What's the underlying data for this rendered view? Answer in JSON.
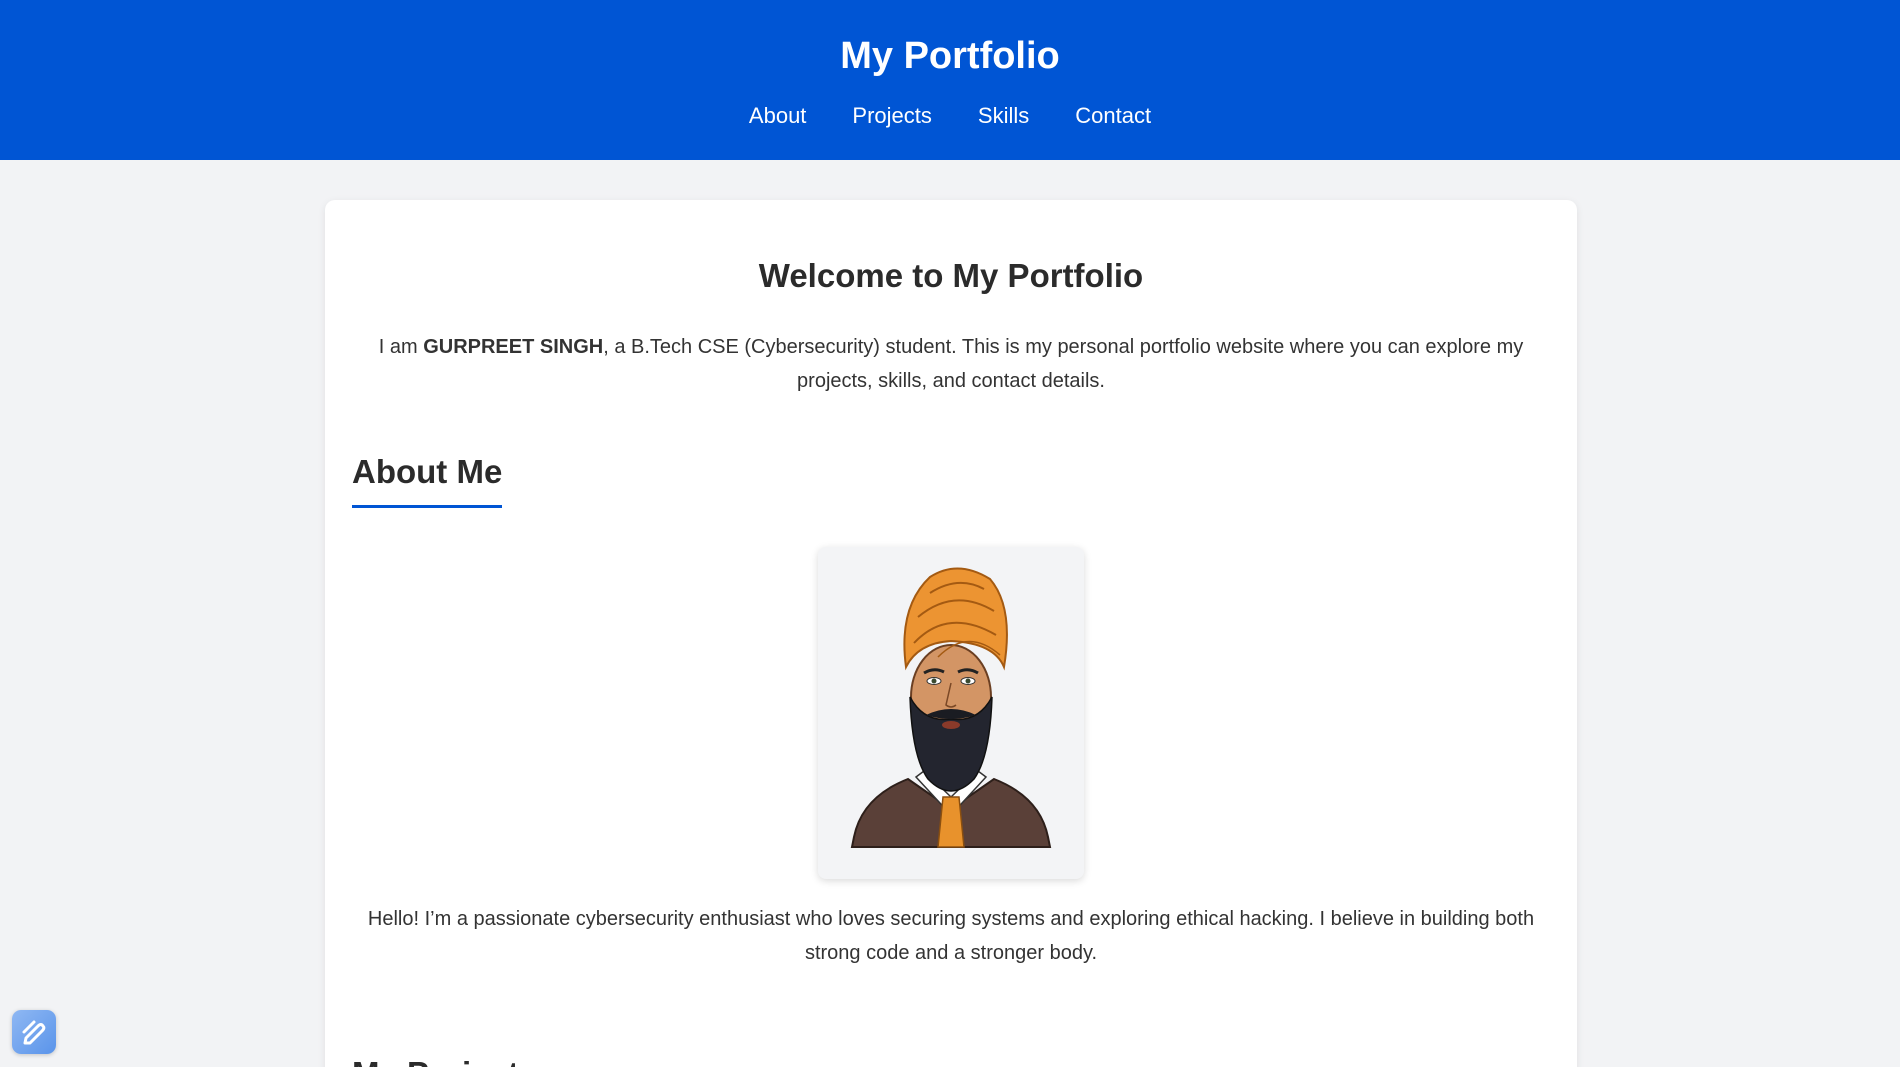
{
  "header": {
    "title": "My Portfolio",
    "nav": [
      {
        "label": "About"
      },
      {
        "label": "Projects"
      },
      {
        "label": "Skills"
      },
      {
        "label": "Contact"
      }
    ],
    "background_color": "#0055d4"
  },
  "welcome": {
    "title": "Welcome to My Portfolio",
    "intro_prefix": "I am ",
    "intro_name": "GURPREET SINGH",
    "intro_suffix": ", a B.Tech CSE (Cybersecurity) student. This is my personal portfolio website where you can explore my projects, skills, and contact details."
  },
  "about": {
    "heading": "About Me",
    "profile_image_alt": "illustrated-portrait",
    "text": "Hello! I’m a passionate cybersecurity enthusiast who loves securing systems and exploring ethical hacking. I believe in building both strong code and a stronger body."
  },
  "projects": {
    "heading": "My Projects"
  },
  "widget": {
    "icon": "edit-pen-icon"
  }
}
